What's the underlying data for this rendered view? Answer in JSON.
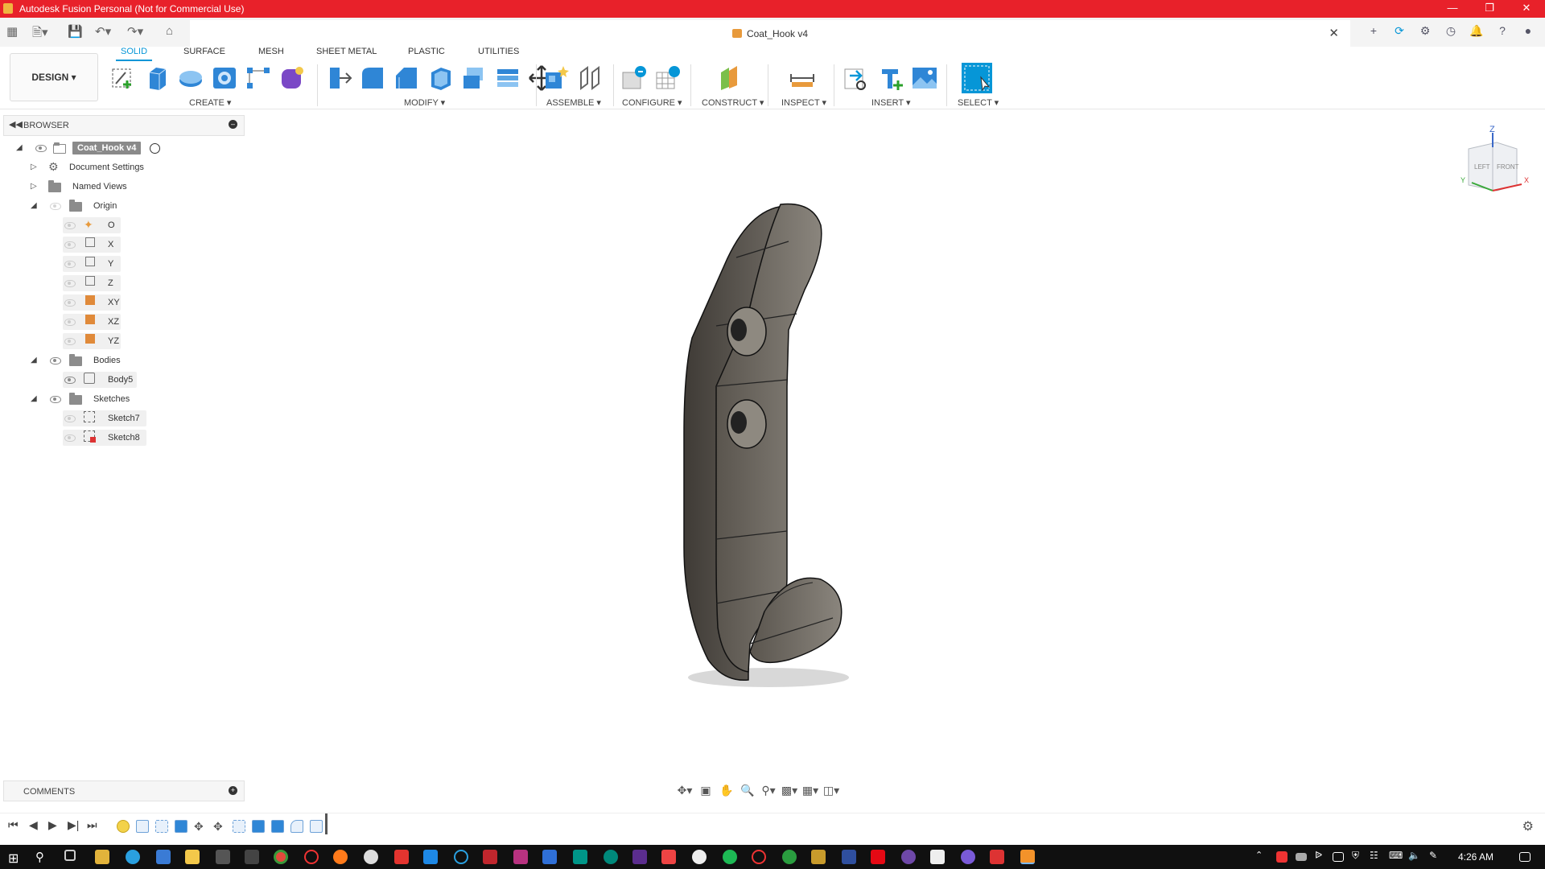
{
  "window": {
    "title": "Autodesk Fusion Personal (Not for Commercial Use)"
  },
  "document": {
    "title": "Coat_Hook v4"
  },
  "workspace": {
    "label": "DESIGN"
  },
  "ribbon": {
    "tabs": [
      {
        "label": "SOLID",
        "active": true
      },
      {
        "label": "SURFACE"
      },
      {
        "label": "MESH"
      },
      {
        "label": "SHEET METAL"
      },
      {
        "label": "PLASTIC"
      },
      {
        "label": "UTILITIES"
      }
    ],
    "groups": {
      "create": "CREATE",
      "modify": "MODIFY",
      "assemble": "ASSEMBLE",
      "configure": "CONFIGURE",
      "construct": "CONSTRUCT",
      "inspect": "INSPECT",
      "insert": "INSERT",
      "select": "SELECT"
    }
  },
  "browser": {
    "title": "BROWSER",
    "root": "Coat_Hook v4",
    "items": {
      "doc_settings": "Document Settings",
      "named_views": "Named Views",
      "origin": "Origin",
      "o": "O",
      "x": "X",
      "y": "Y",
      "z": "Z",
      "xy": "XY",
      "xz": "XZ",
      "yz": "YZ",
      "bodies": "Bodies",
      "body5": "Body5",
      "sketches": "Sketches",
      "sketch7": "Sketch7",
      "sketch8": "Sketch8"
    }
  },
  "comments": {
    "title": "COMMENTS"
  },
  "viewcube": {
    "top": "Z",
    "left": "LEFT",
    "front": "FRONT",
    "axis_y": "Y",
    "axis_x": "X"
  },
  "taskbar": {
    "time": "4:26 AM"
  },
  "colors": {
    "titlebar": "#e8212a",
    "accent": "#0696d7",
    "model": "#6e6a64"
  }
}
